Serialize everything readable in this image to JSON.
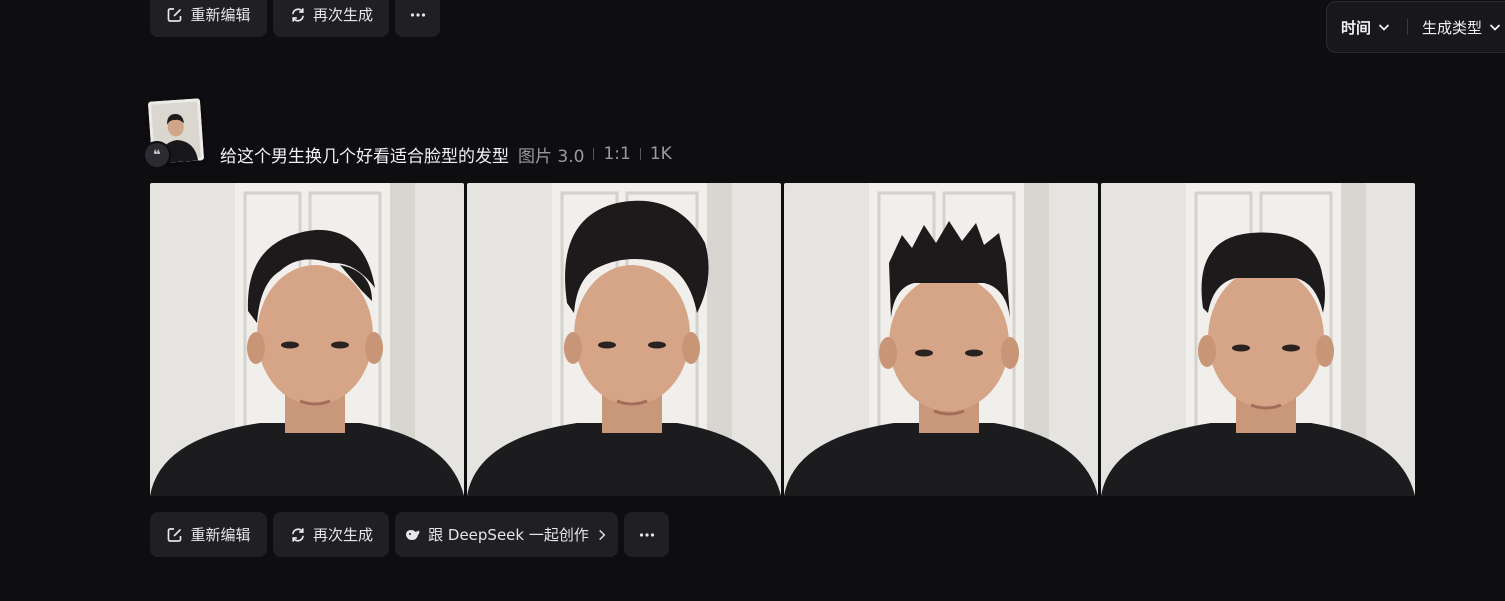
{
  "top_actions": {
    "edit_label": "重新编辑",
    "regen_label": "再次生成"
  },
  "filter": {
    "time_label": "时间",
    "type_label": "生成类型"
  },
  "item": {
    "prompt": "给这个男生换几个好看适合脸型的发型",
    "model": "图片 3.0",
    "ratio": "1:1",
    "resolution": "1K",
    "images": [
      {
        "hair_style": "side-swept"
      },
      {
        "hair_style": "voluminous-quiff"
      },
      {
        "hair_style": "spiky"
      },
      {
        "hair_style": "pompadour"
      }
    ]
  },
  "bottom_actions": {
    "edit_label": "重新编辑",
    "regen_label": "再次生成",
    "deepseek_label": "跟 DeepSeek 一起创作"
  },
  "colors": {
    "background": "#0e0e11",
    "button_bg": "#1f1f24",
    "text_primary": "#f2f2f4",
    "text_muted": "#9a9aa2"
  }
}
